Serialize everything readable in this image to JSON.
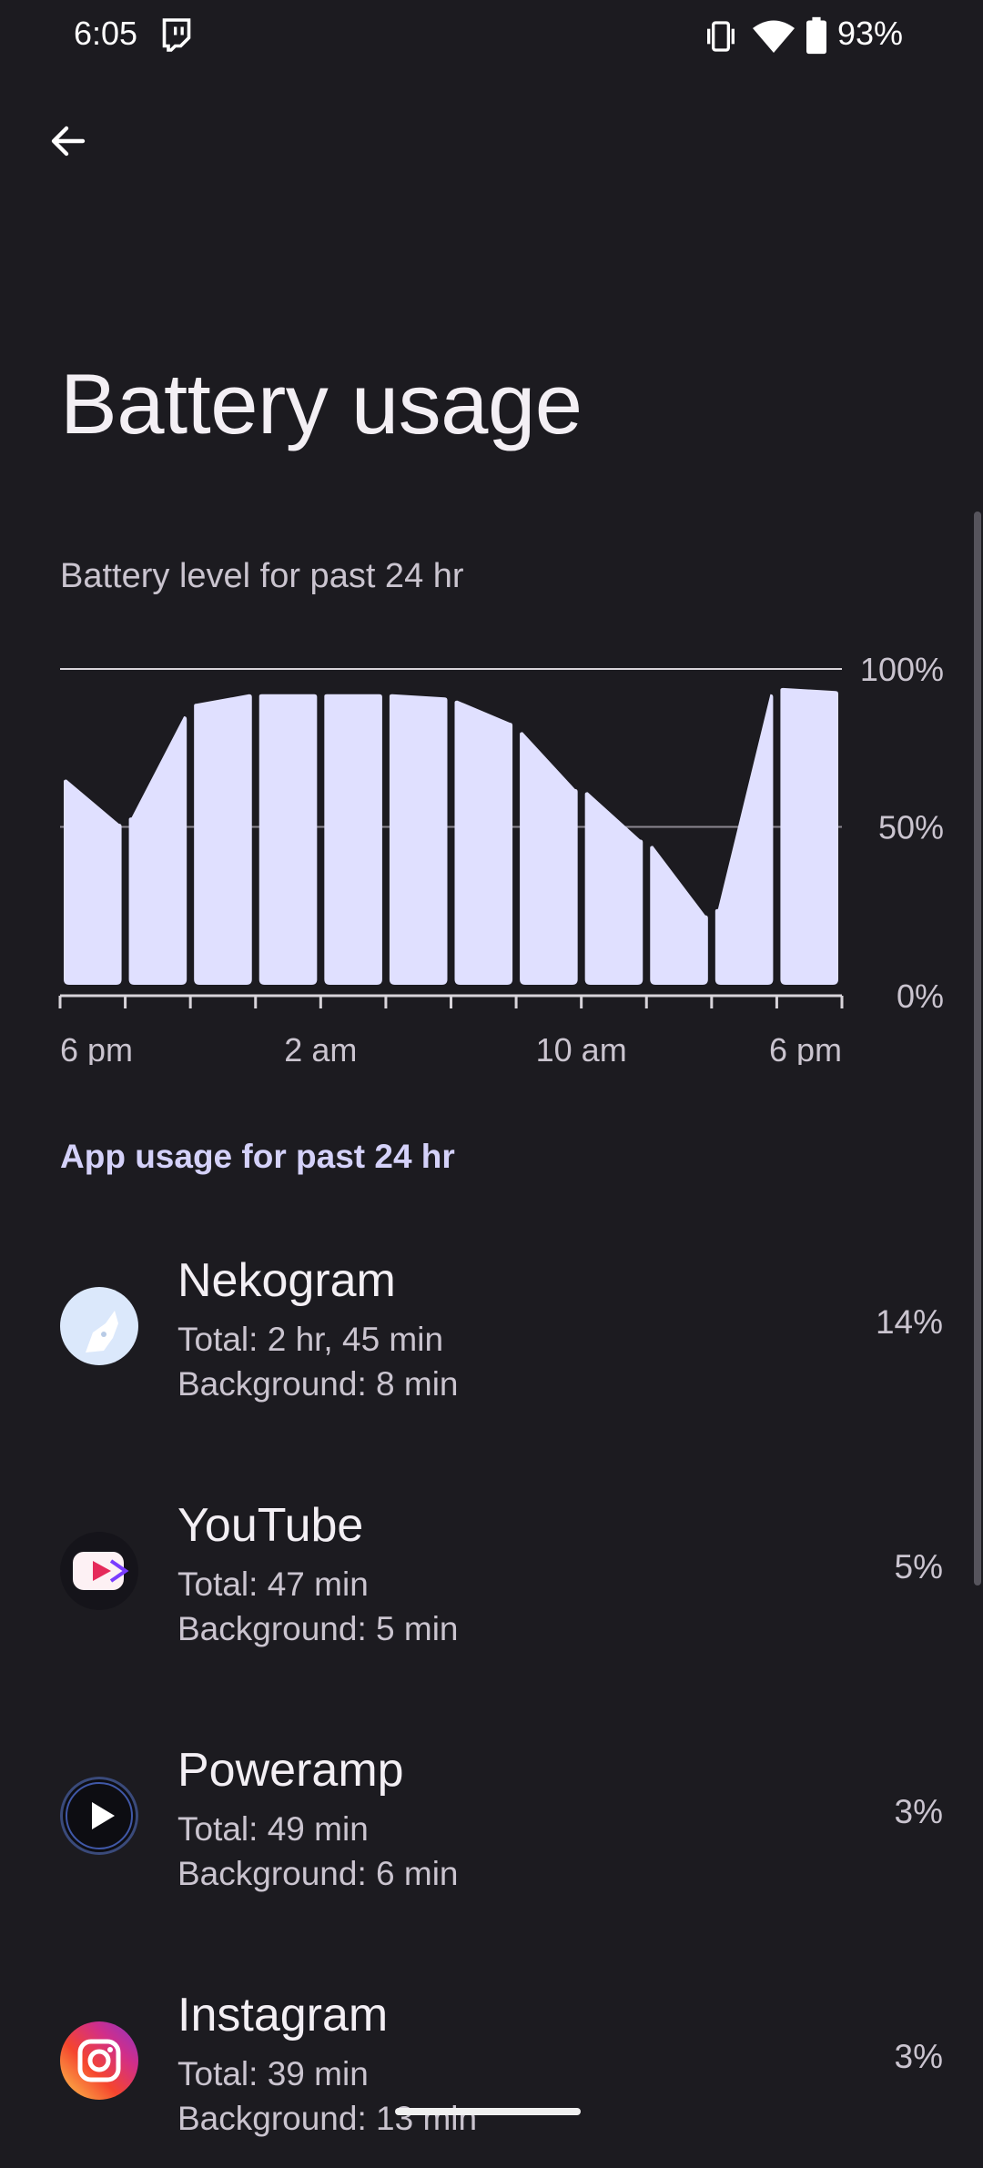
{
  "status_bar": {
    "time": "6:05",
    "battery_percent": "93%"
  },
  "header": {
    "title": "Battery usage"
  },
  "chart_caption": "Battery level for past 24 hr",
  "chart_data": {
    "type": "area",
    "title": "",
    "xlabel": "",
    "ylabel": "",
    "y_tick_labels": [
      "100%",
      "50%",
      "0%"
    ],
    "x_tick_labels": [
      "6 pm",
      "2 am",
      "10 am",
      "6 pm"
    ],
    "ylim": [
      0,
      100
    ],
    "grid": true,
    "bars": [
      {
        "start": 65,
        "end": 51
      },
      {
        "start": 53,
        "end": 85
      },
      {
        "start": 89,
        "end": 92
      },
      {
        "start": 92,
        "end": 92
      },
      {
        "start": 92,
        "end": 92
      },
      {
        "start": 92,
        "end": 91
      },
      {
        "start": 90,
        "end": 83
      },
      {
        "start": 80,
        "end": 62
      },
      {
        "start": 61,
        "end": 46
      },
      {
        "start": 44,
        "end": 22
      },
      {
        "start": 24,
        "end": 92
      },
      {
        "start": 94,
        "end": 93
      }
    ]
  },
  "section_header": "App usage for past 24 hr",
  "apps": [
    {
      "name": "Nekogram",
      "total": "Total: 2 hr, 45 min",
      "background": "Background: 8 min",
      "percent": "14%"
    },
    {
      "name": "YouTube",
      "total": "Total: 47 min",
      "background": "Background: 5 min",
      "percent": "5%"
    },
    {
      "name": "Poweramp",
      "total": "Total: 49 min",
      "background": "Background: 6 min",
      "percent": "3%"
    },
    {
      "name": "Instagram",
      "total": "Total: 39 min",
      "background": "Background: 13 min",
      "percent": "3%"
    }
  ],
  "colors": {
    "background": "#1c1b20",
    "bar_fill": "#e0e0ff",
    "accent_header": "#d4d1f9"
  }
}
